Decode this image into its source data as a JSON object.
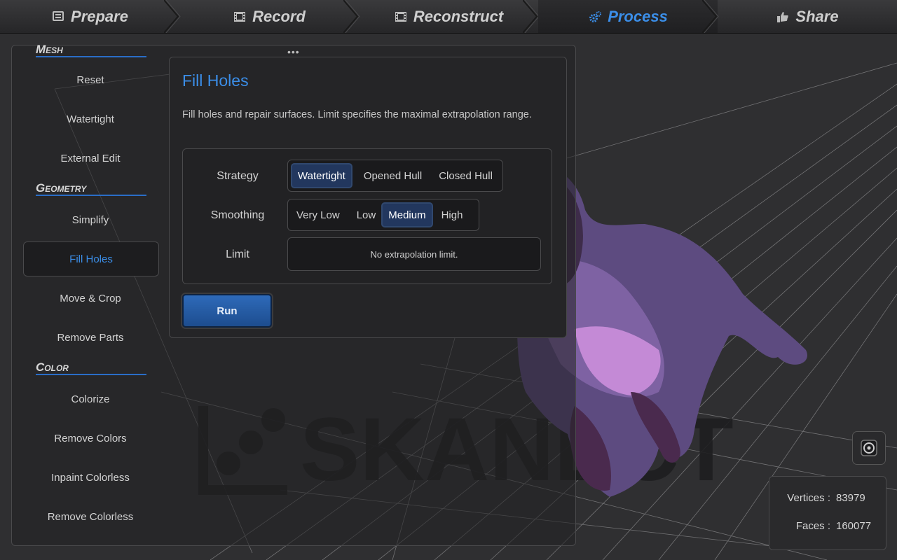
{
  "nav": {
    "tabs": [
      {
        "label": "Prepare",
        "icon": "prepare-icon"
      },
      {
        "label": "Record",
        "icon": "film-icon"
      },
      {
        "label": "Reconstruct",
        "icon": "film-icon"
      },
      {
        "label": "Process",
        "icon": "gears-icon"
      },
      {
        "label": "Share",
        "icon": "thumbs-up-icon"
      }
    ],
    "active": "Process"
  },
  "sidebar": {
    "sections": {
      "mesh": "Mesh",
      "geometry": "Geometry",
      "color": "Color"
    },
    "items": [
      "Reset",
      "Watertight",
      "External Edit",
      "Simplify",
      "Fill Holes",
      "Move & Crop",
      "Remove Parts",
      "Colorize",
      "Remove Colors",
      "Inpaint Colorless",
      "Remove Colorless"
    ],
    "active": "Fill Holes"
  },
  "panel": {
    "title": "Fill Holes",
    "description": "Fill holes and repair surfaces. Limit specifies the maximal extrapolation range.",
    "strategy": {
      "label": "Strategy",
      "options": [
        "Watertight",
        "Opened Hull",
        "Closed Hull"
      ],
      "selected": "Watertight"
    },
    "smoothing": {
      "label": "Smoothing",
      "options": [
        "Very Low",
        "Low",
        "Medium",
        "High"
      ],
      "selected": "Medium"
    },
    "limit": {
      "label": "Limit",
      "value": "No extrapolation limit."
    },
    "run_label": "Run"
  },
  "watermark": "SKANECT",
  "stats": {
    "vertices_label": "Vertices :",
    "vertices": "83979",
    "faces_label": "Faces :",
    "faces": "160077"
  },
  "colors": {
    "accent": "#3b8ee8",
    "run_button": "#2a63b0",
    "selected_segment": "#22375e"
  }
}
